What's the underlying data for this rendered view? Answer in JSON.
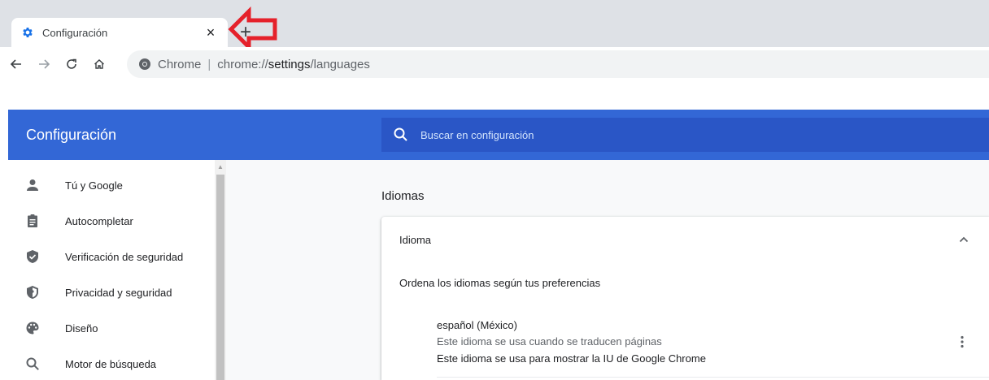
{
  "browser": {
    "tab": {
      "title": "Configuración",
      "close": "×"
    },
    "new_tab": "+",
    "omnibox": {
      "site": "Chrome",
      "separator": "|",
      "url_prefix": "chrome://",
      "url_bold": "settings",
      "url_suffix": "/languages"
    }
  },
  "settings": {
    "header_title": "Configuración",
    "search_placeholder": "Buscar en configuración",
    "sidebar": {
      "items": [
        {
          "label": "Tú y Google",
          "icon": "person-icon"
        },
        {
          "label": "Autocompletar",
          "icon": "clipboard-icon"
        },
        {
          "label": "Verificación de seguridad",
          "icon": "shield-check-icon"
        },
        {
          "label": "Privacidad y seguridad",
          "icon": "shield-half-icon"
        },
        {
          "label": "Diseño",
          "icon": "palette-icon"
        },
        {
          "label": "Motor de búsqueda",
          "icon": "search-icon"
        }
      ]
    },
    "main": {
      "section_title": "Idiomas",
      "card": {
        "row_title": "Idioma",
        "order_text": "Ordena los idiomas según tus preferencias",
        "language": {
          "name": "español (México)",
          "note_translate": "Este idioma se usa cuando se traducen páginas",
          "note_ui": "Este idioma se usa para mostrar la IU de Google Chrome"
        }
      }
    }
  },
  "colors": {
    "header_blue": "#3367d6",
    "search_blue": "#2a56c6",
    "annotation_red": "#e5212b"
  }
}
